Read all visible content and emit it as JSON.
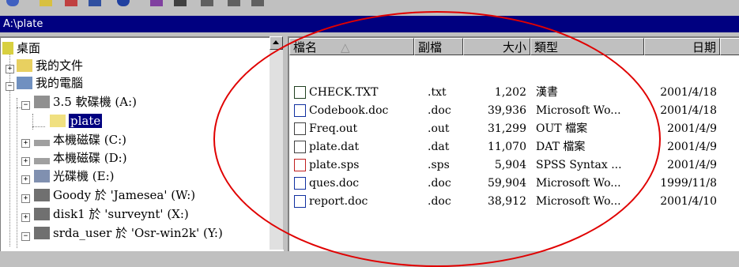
{
  "window": {
    "title": "A:\\plate"
  },
  "tree": {
    "items": [
      {
        "label": "桌面",
        "icon": "desktop-icon"
      },
      {
        "label": "我的文件",
        "icon": "my-documents-icon"
      },
      {
        "label": "我的電腦",
        "icon": "my-computer-icon"
      },
      {
        "label": "3.5 軟碟機 (A:)",
        "icon": "floppy-drive-icon"
      },
      {
        "label": "plate",
        "icon": "open-folder-icon"
      },
      {
        "label": "本機磁碟 (C:)",
        "icon": "hard-drive-icon"
      },
      {
        "label": "本機磁碟 (D:)",
        "icon": "hard-drive-icon"
      },
      {
        "label": "光碟機 (E:)",
        "icon": "cd-drive-icon"
      },
      {
        "label": "Goody 於 'Jamesea' (W:)",
        "icon": "network-drive-icon"
      },
      {
        "label": "disk1 於 'surveynt' (X:)",
        "icon": "network-drive-icon"
      },
      {
        "label": "srda_user 於 'Osr-win2k' (Y:)",
        "icon": "network-drive-icon"
      }
    ]
  },
  "list": {
    "headers": {
      "name": "檔名",
      "ext": "副檔",
      "size": "大小",
      "type": "類型",
      "date": "日期"
    },
    "files": [
      {
        "name": "CHECK.TXT",
        "ext": ".txt",
        "size": "1,202",
        "type": "漢書",
        "date": "2001/4/18",
        "icon": "text-file-icon"
      },
      {
        "name": "Codebook.doc",
        "ext": ".doc",
        "size": "39,936",
        "type": "Microsoft Wo...",
        "date": "2001/4/18",
        "icon": "word-doc-icon"
      },
      {
        "name": "Freq.out",
        "ext": ".out",
        "size": "31,299",
        "type": "OUT 檔案",
        "date": "2001/4/9",
        "icon": "generic-file-icon"
      },
      {
        "name": "plate.dat",
        "ext": ".dat",
        "size": "11,070",
        "type": "DAT 檔案",
        "date": "2001/4/9",
        "icon": "generic-file-icon"
      },
      {
        "name": "plate.sps",
        "ext": ".sps",
        "size": "5,904",
        "type": "SPSS Syntax ...",
        "date": "2001/4/9",
        "icon": "spss-syntax-icon"
      },
      {
        "name": "ques.doc",
        "ext": ".doc",
        "size": "59,904",
        "type": "Microsoft Wo...",
        "date": "1999/11/8",
        "icon": "word-doc-icon"
      },
      {
        "name": "report.doc",
        "ext": ".doc",
        "size": "38,912",
        "type": "Microsoft Wo...",
        "date": "2001/4/10",
        "icon": "word-doc-icon"
      }
    ]
  },
  "annotation": {
    "color": "#e00000",
    "shape": "ellipse"
  },
  "colors": {
    "titlebar": "#000080",
    "selection": "#000080",
    "chrome": "#c0c0c0"
  }
}
